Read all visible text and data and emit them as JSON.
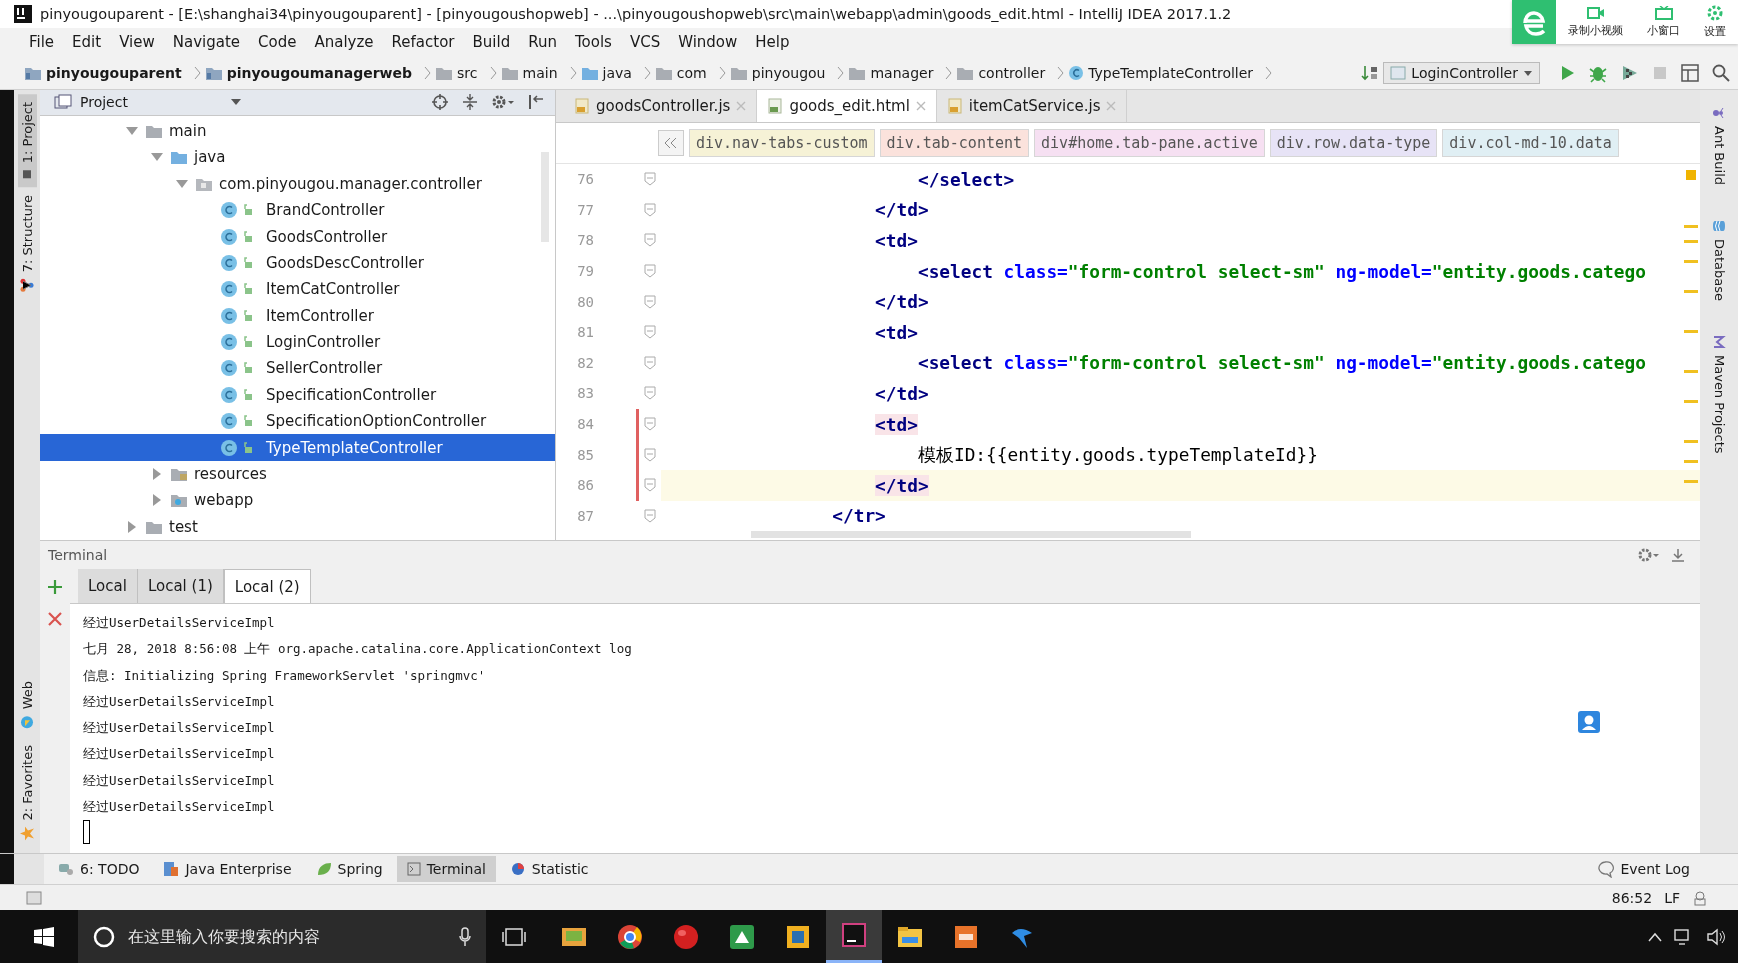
{
  "window": {
    "title": "pinyougouparent - [E:\\shanghai34\\pinyougouparent] - [pinyougoushopweb] - ...\\pinyougoushopweb\\src\\main\\webapp\\admin\\goods_edit.html - IntelliJ IDEA 2017.1.2"
  },
  "recorder": {
    "buttons": [
      {
        "label": "录制小视频",
        "kind": "record"
      },
      {
        "label": "小窗口",
        "kind": "window"
      },
      {
        "label": "设置",
        "kind": "settings"
      }
    ]
  },
  "menu": [
    "File",
    "Edit",
    "View",
    "Navigate",
    "Code",
    "Analyze",
    "Refactor",
    "Build",
    "Run",
    "Tools",
    "VCS",
    "Window",
    "Help"
  ],
  "navbar": {
    "crumbs": [
      {
        "label": "pinyougouparent",
        "kind": "module"
      },
      {
        "label": "pinyougoumanagerweb",
        "kind": "module"
      },
      {
        "label": "src",
        "kind": "folder"
      },
      {
        "label": "main",
        "kind": "folder"
      },
      {
        "label": "java",
        "kind": "source"
      },
      {
        "label": "com",
        "kind": "folder"
      },
      {
        "label": "pinyougou",
        "kind": "folder"
      },
      {
        "label": "manager",
        "kind": "folder"
      },
      {
        "label": "controller",
        "kind": "folder"
      },
      {
        "label": "TypeTemplateController",
        "kind": "class"
      }
    ],
    "run_config": "LoginController"
  },
  "left_tool_tabs": {
    "top": [
      {
        "label": "1: Project",
        "selected": true,
        "kind": "project"
      },
      {
        "label": "7: Structure",
        "selected": false,
        "kind": "structure"
      }
    ],
    "bottom": [
      {
        "label": "Web",
        "selected": false,
        "kind": "web"
      },
      {
        "label": "2: Favorites",
        "selected": false,
        "kind": "favorites"
      }
    ]
  },
  "right_tool_tabs": [
    {
      "label": "Ant Build",
      "kind": "ant"
    },
    {
      "label": "Database",
      "kind": "database"
    },
    {
      "label": "Maven Projects",
      "kind": "maven"
    }
  ],
  "project": {
    "title": "Project",
    "tree": [
      {
        "label": "main",
        "kind": "folder",
        "expanded": true,
        "selected": false,
        "children": [
          {
            "label": "java",
            "kind": "source",
            "expanded": true,
            "selected": false,
            "children": [
              {
                "label": "com.pinyougou.manager.controller",
                "kind": "package",
                "expanded": true,
                "selected": false,
                "children": [
                  {
                    "label": "BrandController",
                    "kind": "class",
                    "selected": false
                  },
                  {
                    "label": "GoodsController",
                    "kind": "class",
                    "selected": false
                  },
                  {
                    "label": "GoodsDescController",
                    "kind": "class",
                    "selected": false
                  },
                  {
                    "label": "ItemCatController",
                    "kind": "class",
                    "selected": false
                  },
                  {
                    "label": "ItemController",
                    "kind": "class",
                    "selected": false
                  },
                  {
                    "label": "LoginController",
                    "kind": "class",
                    "selected": false
                  },
                  {
                    "label": "SellerController",
                    "kind": "class",
                    "selected": false
                  },
                  {
                    "label": "SpecificationController",
                    "kind": "class",
                    "selected": false
                  },
                  {
                    "label": "SpecificationOptionController",
                    "kind": "class",
                    "selected": false
                  },
                  {
                    "label": "TypeTemplateController",
                    "kind": "class",
                    "selected": true
                  }
                ]
              }
            ]
          },
          {
            "label": "resources",
            "kind": "resources",
            "expanded": false,
            "selected": false
          },
          {
            "label": "webapp",
            "kind": "web",
            "expanded": false,
            "selected": false
          }
        ]
      },
      {
        "label": "test",
        "kind": "folder",
        "expanded": false,
        "selected": false
      }
    ]
  },
  "editor": {
    "tabs": [
      {
        "label": "goodsController.js",
        "kind": "js",
        "selected": false
      },
      {
        "label": "goods_edit.html",
        "kind": "html",
        "selected": true
      },
      {
        "label": "itemCatService.js",
        "kind": "js",
        "selected": false
      }
    ],
    "breadcrumbs": [
      {
        "label": "div.nav-tabs-custom",
        "color": "#f6f2d6"
      },
      {
        "label": "div.tab-content",
        "color": "#fbe2dc"
      },
      {
        "label": "div#home.tab-pane.active",
        "color": "#f6e0f2"
      },
      {
        "label": "div.row.data-type",
        "color": "#e7e3f6"
      },
      {
        "label": "div.col-md-10.data",
        "color": "#e0eff4"
      }
    ],
    "lines": [
      {
        "number": "76",
        "current": false,
        "modified": false,
        "tokens": [
          {
            "kind": "tag",
            "text": "                        </select>"
          }
        ]
      },
      {
        "number": "77",
        "current": false,
        "modified": false,
        "tokens": [
          {
            "kind": "tag",
            "text": "                    </td>"
          }
        ]
      },
      {
        "number": "78",
        "current": false,
        "modified": false,
        "tokens": [
          {
            "kind": "tag",
            "text": "                    <td>"
          }
        ]
      },
      {
        "number": "79",
        "current": false,
        "modified": false,
        "tokens": [
          {
            "kind": "tag",
            "text": "                        <select"
          },
          {
            "kind": "attr",
            "text": " class="
          },
          {
            "kind": "value",
            "text": "\"form-control select-sm\""
          },
          {
            "kind": "attr",
            "text": " ng-model="
          },
          {
            "kind": "value",
            "text": "\"entity.goods.catego"
          }
        ]
      },
      {
        "number": "80",
        "current": false,
        "modified": false,
        "tokens": [
          {
            "kind": "tag",
            "text": "                    </td>"
          }
        ]
      },
      {
        "number": "81",
        "current": false,
        "modified": false,
        "tokens": [
          {
            "kind": "tag",
            "text": "                    <td>"
          }
        ]
      },
      {
        "number": "82",
        "current": false,
        "modified": false,
        "tokens": [
          {
            "kind": "tag",
            "text": "                        <select"
          },
          {
            "kind": "attr",
            "text": " class="
          },
          {
            "kind": "value",
            "text": "\"form-control select-sm\""
          },
          {
            "kind": "attr",
            "text": " ng-model="
          },
          {
            "kind": "value",
            "text": "\"entity.goods.catego"
          }
        ]
      },
      {
        "number": "83",
        "current": false,
        "modified": false,
        "tokens": [
          {
            "kind": "tag",
            "text": "                    </td>"
          }
        ]
      },
      {
        "number": "84",
        "current": false,
        "modified": true,
        "tokens": [
          {
            "kind": "tag-match",
            "text": "                    <td>"
          }
        ]
      },
      {
        "number": "85",
        "current": false,
        "modified": true,
        "tokens": [
          {
            "kind": "text",
            "text": "                        模板ID:{{entity.goods.typeTemplateId}}"
          }
        ]
      },
      {
        "number": "86",
        "current": true,
        "modified": true,
        "tokens": [
          {
            "kind": "tag-match",
            "text": "                    </td>"
          }
        ]
      },
      {
        "number": "87",
        "current": false,
        "modified": false,
        "tokens": [
          {
            "kind": "tag",
            "text": "                </tr>"
          }
        ]
      }
    ]
  },
  "terminal": {
    "title": "Terminal",
    "tabs": [
      {
        "label": "Local",
        "selected": false
      },
      {
        "label": "Local (1)",
        "selected": false
      },
      {
        "label": "Local (2)",
        "selected": true
      }
    ],
    "lines": [
      "经过UserDetailsServiceImpl",
      "七月 28, 2018 8:56:08 上午 org.apache.catalina.core.ApplicationContext log",
      "信息: Initializing Spring FrameworkServlet 'springmvc'",
      "经过UserDetailsServiceImpl",
      "经过UserDetailsServiceImpl",
      "经过UserDetailsServiceImpl",
      "经过UserDetailsServiceImpl",
      "经过UserDetailsServiceImpl"
    ]
  },
  "tool_windows": {
    "left": [
      {
        "label": "6: TODO",
        "kind": "todo",
        "selected": false
      },
      {
        "label": "Java Enterprise",
        "kind": "javaee",
        "selected": false
      },
      {
        "label": "Spring",
        "kind": "spring",
        "selected": false
      },
      {
        "label": "Terminal",
        "kind": "terminal",
        "selected": true
      },
      {
        "label": "Statistic",
        "kind": "statistic",
        "selected": false
      }
    ],
    "right": [
      {
        "label": "Event Log",
        "kind": "eventlog",
        "selected": false
      }
    ]
  },
  "status_bar": {
    "position": "86:52",
    "line_separator": "LF"
  },
  "taskbar": {
    "search": {
      "placeholder": "在这里输入你要搜索的内容"
    },
    "apps": [
      {
        "kind": "files",
        "selected": false
      },
      {
        "kind": "chrome",
        "selected": false
      },
      {
        "kind": "red",
        "selected": false
      },
      {
        "kind": "green",
        "selected": false
      },
      {
        "kind": "box",
        "selected": false
      },
      {
        "kind": "idea",
        "selected": true
      },
      {
        "kind": "explorer",
        "selected": false
      },
      {
        "kind": "pdf",
        "selected": false
      },
      {
        "kind": "bird",
        "selected": false
      }
    ]
  }
}
